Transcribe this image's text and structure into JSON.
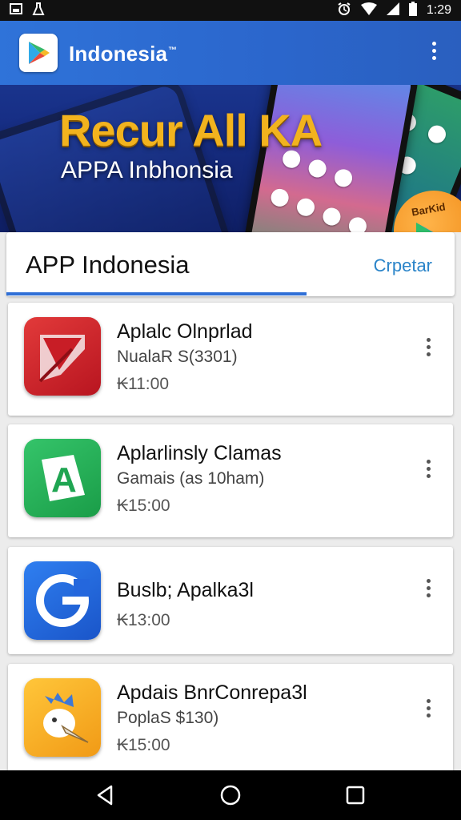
{
  "status_bar": {
    "time": "1:29",
    "left_icons": [
      "image-icon",
      "flask-icon"
    ],
    "right_icons": [
      "alarm-icon",
      "wifi-icon",
      "signal-icon",
      "battery-icon"
    ]
  },
  "header": {
    "brand": "Indonesia",
    "trademark": "™",
    "menu_icon": "overflow-menu-icon"
  },
  "hero": {
    "title": "Recur All KA",
    "subtitle": "APPA Inbhonsia",
    "badge_text": "BarKid"
  },
  "tab_bar": {
    "title": "APP Indonesia",
    "action": "Crpetar",
    "indicator_progress": 0.67
  },
  "apps": [
    {
      "name": "Aplalc Olnprlad",
      "subtitle": "NualaR S(3301)",
      "price": "₭11:00",
      "icon": "red-arrow-app-icon",
      "color": "#d7282f"
    },
    {
      "name": "Aplarlinsly Clamas",
      "subtitle": "Gamais (as 10ham)",
      "price": "₭15:00",
      "icon": "green-a-app-icon",
      "color": "#27b35a"
    },
    {
      "name": "Buslb; Apalka3l",
      "subtitle": "",
      "price": "₭13:00",
      "icon": "blue-g-app-icon",
      "color": "#2467dd"
    },
    {
      "name": "Apdais BnrConrepa3l",
      "subtitle": "PoplaS $130)",
      "price": "₭15:00",
      "icon": "yellow-bird-app-icon",
      "color": "#f5b028"
    }
  ],
  "nav_bar": {
    "buttons": [
      "back-icon",
      "home-icon",
      "recents-icon"
    ]
  },
  "colors": {
    "accent": "#2f6fd6",
    "header_blue": "#2f73d9",
    "hero_gold": "#f2b31e"
  }
}
